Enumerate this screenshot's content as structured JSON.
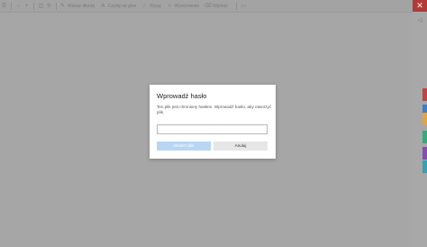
{
  "toolbar": {
    "items": [
      {
        "icon": "draw-icon",
        "label": "Wskaż dłonią"
      },
      {
        "icon": "text-icon",
        "label": "Czytaj na głos"
      },
      {
        "icon": "eraser-icon",
        "label": "Rysuj"
      },
      {
        "icon": "highlight-icon",
        "label": "Wyróżnienie"
      },
      {
        "icon": "erase-icon",
        "label": "Wymaż"
      }
    ]
  },
  "window": {
    "close_glyph": "✕",
    "accent_close": "#b53a35"
  },
  "side_tabs": [
    {
      "color": "#c9413d"
    },
    {
      "color": "#3b7fd0"
    },
    {
      "color": "#e5a53a"
    },
    {
      "color": "#2eaf7a"
    },
    {
      "color": "#8a4bb8"
    },
    {
      "color": "#2ea4b8"
    }
  ],
  "dialog": {
    "title": "Wprowadź hasło",
    "message": "Ten plik jest chroniony hasłem. Wprowadź hasło, aby otworzyć plik.",
    "password_value": "",
    "open_label": "Otwórz plik",
    "cancel_label": "Anuluj"
  }
}
